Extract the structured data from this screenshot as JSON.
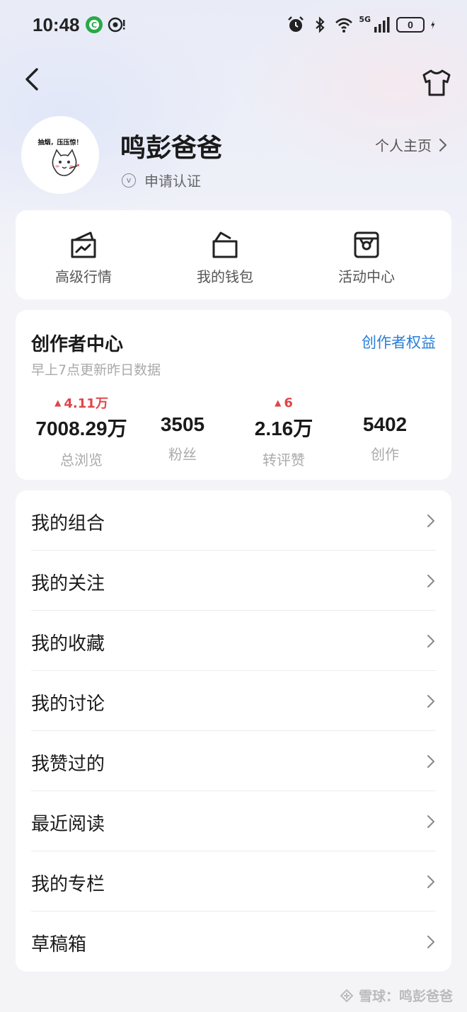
{
  "status_bar": {
    "time": "10:48",
    "network": "5G",
    "battery": "0"
  },
  "profile": {
    "username": "鸣彭爸爸",
    "verify_label": "申请认证",
    "verify_icon_glyph": "v",
    "homepage_label": "个人主页",
    "avatar_caption": "抽烟，压压惊！"
  },
  "shortcuts": [
    {
      "label": "高级行情",
      "icon": "chart-card-icon"
    },
    {
      "label": "我的钱包",
      "icon": "wallet-icon"
    },
    {
      "label": "活动中心",
      "icon": "shopping-bag-icon"
    }
  ],
  "creator_center": {
    "title": "创作者中心",
    "subtitle": "早上7点更新昨日数据",
    "link_label": "创作者权益",
    "stats": [
      {
        "delta": "4.11万",
        "value": "7008.29万",
        "label": "总浏览"
      },
      {
        "delta": "",
        "value": "3505",
        "label": "粉丝"
      },
      {
        "delta": "6",
        "value": "2.16万",
        "label": "转评赞"
      },
      {
        "delta": "",
        "value": "5402",
        "label": "创作"
      }
    ],
    "delta_color": "#e0454a",
    "link_color": "#2a7fd8"
  },
  "menu": [
    {
      "label": "我的组合"
    },
    {
      "label": "我的关注"
    },
    {
      "label": "我的收藏"
    },
    {
      "label": "我的讨论"
    },
    {
      "label": "我赞过的"
    },
    {
      "label": "最近阅读"
    },
    {
      "label": "我的专栏"
    },
    {
      "label": "草稿箱"
    }
  ],
  "watermark": {
    "text": "雪球：鸣彭爸爸"
  }
}
